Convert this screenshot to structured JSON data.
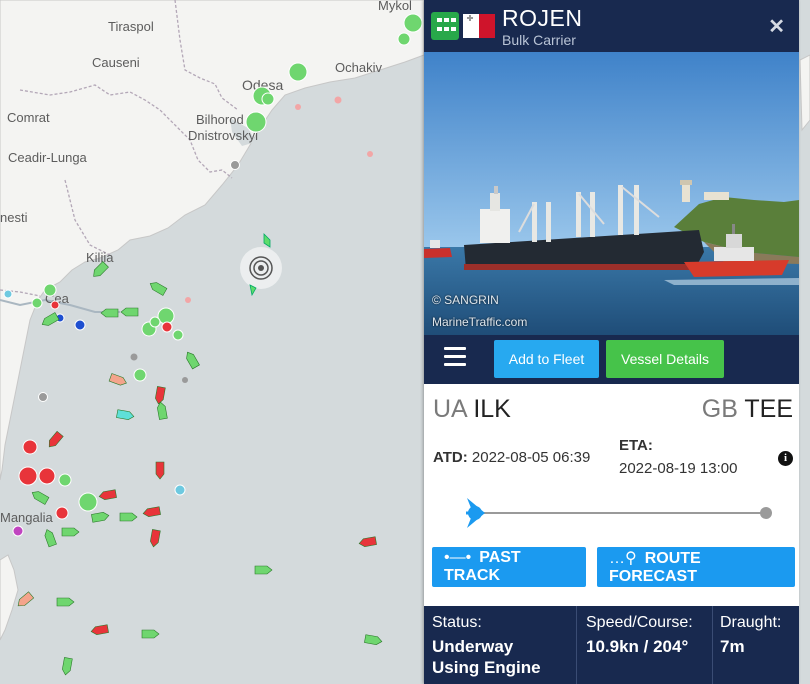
{
  "map": {
    "places": [
      "Tiraspol",
      "Mykol",
      "Causeni",
      "Odesa",
      "Ochakiv",
      "Comrat",
      "Bilhorod",
      "Dnistrovskyi",
      "Ceadir-Lunga",
      "nesti",
      "Kiliia",
      "Cea",
      "Mangalia"
    ]
  },
  "vessel": {
    "name": "ROJEN",
    "type": "Bulk Carrier",
    "flag": "Malta",
    "close_icon": "close-icon",
    "grid_icon": "grid-icon"
  },
  "photo": {
    "credit_owner": "© SANGRIN",
    "credit_site": "MarineTraffic.com"
  },
  "actions": {
    "add_to_fleet": "Add to Fleet",
    "vessel_details": "Vessel Details",
    "menu_icon": "hamburger-menu-icon"
  },
  "voyage": {
    "departure_country": "UA",
    "departure_port": "ILK",
    "arrival_country": "GB",
    "arrival_port": "TEE",
    "atd_label": "ATD:",
    "atd_value": "2022-08-05 06:39",
    "eta_label": "ETA:",
    "eta_value": "2022-08-19 13:00",
    "info_icon": "info-icon",
    "progress": 0.03
  },
  "tracking": {
    "past_track": "PAST TRACK",
    "route_forecast": "ROUTE FORECAST"
  },
  "status": {
    "status_label": "Status:",
    "status_value_line1": "Underway",
    "status_value_line2": "Using Engine",
    "speed_label": "Speed/Course:",
    "speed_value": "10.9kn / 204°",
    "draught_label": "Draught:",
    "draught_value": "7m"
  },
  "colors": {
    "panel_header": "#18294f",
    "blue_button": "#27a9f0",
    "green_button": "#46c34a",
    "cargo_ship": "#6fd66f",
    "tanker": "#e8343a"
  }
}
